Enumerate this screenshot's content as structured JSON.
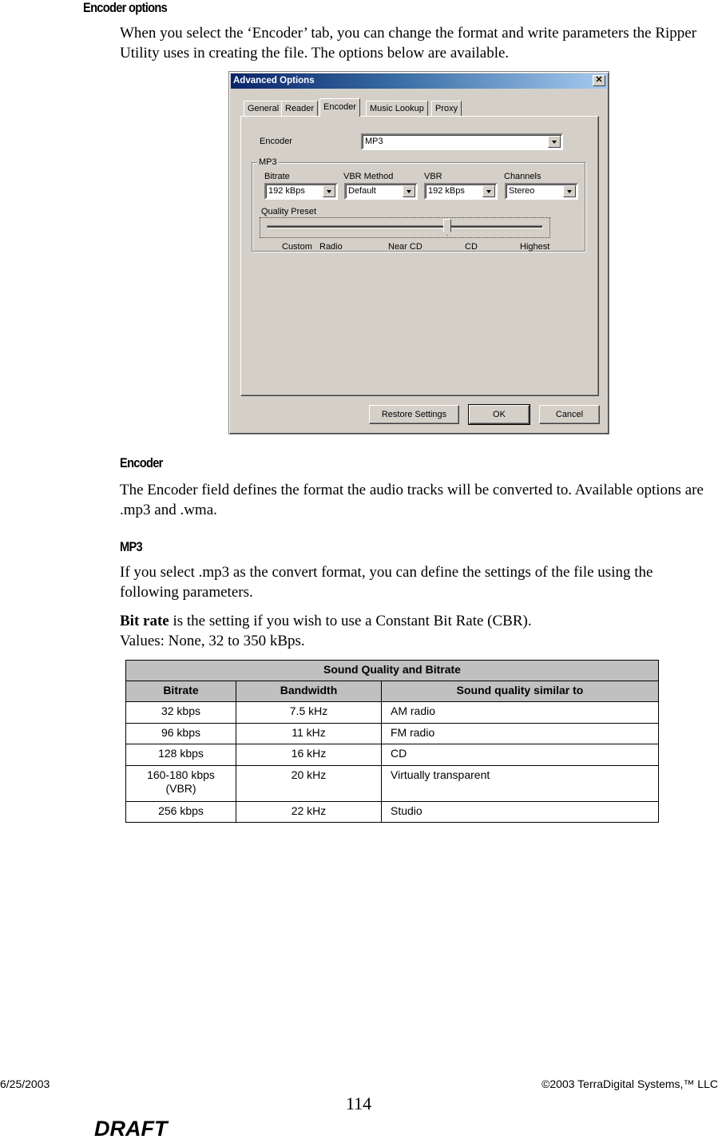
{
  "heading": "Encoder options",
  "intro": "When you select the ‘Encoder’ tab, you can change the format and write parameters the Ripper Utility uses in creating the file.  The options below are available.",
  "dialog": {
    "title": "Advanced Options",
    "close_icon": "✕",
    "tabs": [
      {
        "label": "General",
        "active": false
      },
      {
        "label": "Reader",
        "active": false
      },
      {
        "label": "Encoder",
        "active": true
      },
      {
        "label": "Music Lookup",
        "active": false
      },
      {
        "label": "Proxy",
        "active": false
      }
    ],
    "encoder_label": "Encoder",
    "encoder_value": "MP3",
    "group_title": "MP3",
    "fields": [
      {
        "label": "Bitrate",
        "value": "192 kBps"
      },
      {
        "label": "VBR Method",
        "value": "Default"
      },
      {
        "label": "VBR",
        "value": "192 kBps"
      },
      {
        "label": "Channels",
        "value": "Stereo"
      }
    ],
    "quality_label": "Quality Preset",
    "quality_ticks": [
      "Custom",
      "Radio",
      "Near CD",
      "CD",
      "Highest"
    ],
    "quality_selected": "CD",
    "buttons": {
      "restore": "Restore Settings",
      "ok": "OK",
      "cancel": "Cancel"
    }
  },
  "sections": {
    "encoder_heading": "Encoder",
    "encoder_text": "The Encoder field defines the format the audio tracks will be converted to.  Available options are .mp3 and .wma.",
    "mp3_heading": "MP3",
    "mp3_text": "If you select .mp3 as the convert format, you can define the settings of the file using the following parameters.",
    "bitrate_term": "Bit rate",
    "bitrate_text": " is the setting if you wish to use a Constant Bit Rate (CBR).",
    "bitrate_values": "Values: None, 32 to 350 kBps."
  },
  "table": {
    "title": "Sound Quality and Bitrate",
    "headers": [
      "Bitrate",
      "Bandwidth",
      "Sound quality similar to"
    ],
    "rows": [
      [
        "32 kbps",
        "7.5 kHz",
        "AM radio"
      ],
      [
        "96 kbps",
        "11 kHz",
        "FM radio"
      ],
      [
        "128 kbps",
        "16 kHz",
        "CD"
      ],
      [
        "160-180 kbps (VBR)",
        "20 kHz",
        "Virtually transparent"
      ],
      [
        "256 kbps",
        "22 kHz",
        "Studio"
      ]
    ]
  },
  "footer": {
    "date": "6/25/2003",
    "copyright": "©2003 TerraDigital Systems,™ LLC",
    "page_number": "114",
    "draft": "DRAFT"
  }
}
